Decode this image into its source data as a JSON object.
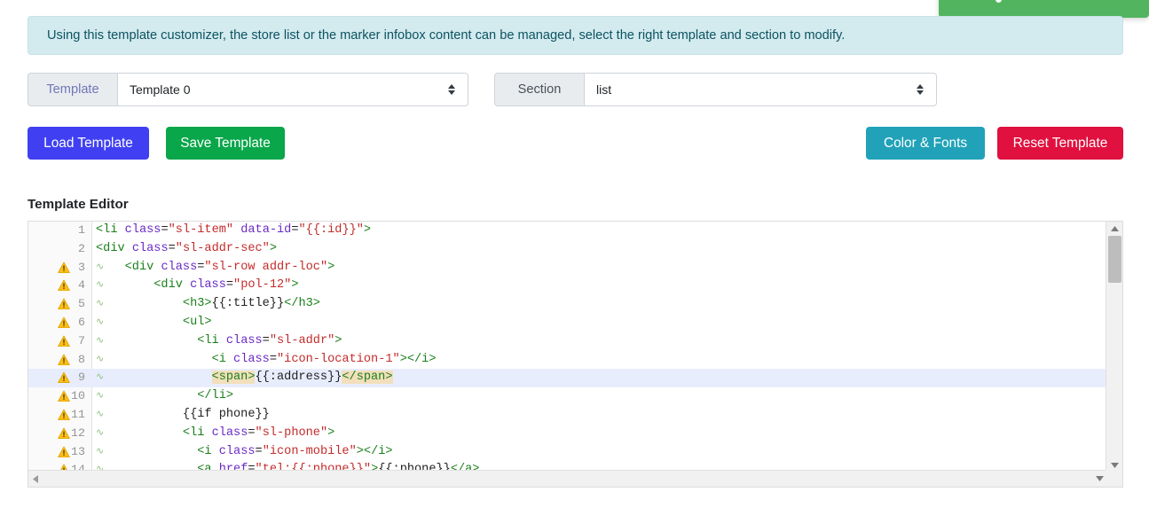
{
  "toast": {
    "name": "success-toast",
    "color": "#52b45f"
  },
  "alert": {
    "text": "Using this template customizer, the store list or the marker infobox content can be managed, select the right template and section to modify.",
    "bg": "#d3eaef",
    "fg": "#0c5460"
  },
  "selectors": {
    "template": {
      "label": "Template",
      "value": "Template 0",
      "options": [
        "Template 0"
      ]
    },
    "section": {
      "label": "Section",
      "value": "list",
      "options": [
        "list"
      ]
    }
  },
  "buttons": {
    "load": {
      "label": "Load Template",
      "color": "#4040f2"
    },
    "save": {
      "label": "Save Template",
      "color": "#09a64a"
    },
    "color_fonts": {
      "label": "Color & Fonts",
      "color": "#21a2b8"
    },
    "reset": {
      "label": "Reset Template",
      "color": "#e0103f"
    }
  },
  "editor": {
    "title": "Template Editor",
    "active_line": 9,
    "lines": [
      {
        "n": "1",
        "warn": false,
        "squiggle": false,
        "tokens": [
          {
            "t": "tag",
            "v": "<li"
          },
          {
            "t": "plain",
            "v": " "
          },
          {
            "t": "attr",
            "v": "class"
          },
          {
            "t": "op",
            "v": "="
          },
          {
            "t": "str",
            "v": "\"sl-item\""
          },
          {
            "t": "plain",
            "v": " "
          },
          {
            "t": "attr",
            "v": "data-id"
          },
          {
            "t": "op",
            "v": "="
          },
          {
            "t": "str",
            "v": "\"{{:id}}\""
          },
          {
            "t": "tag",
            "v": ">"
          }
        ]
      },
      {
        "n": "2",
        "warn": false,
        "squiggle": false,
        "tokens": [
          {
            "t": "tag",
            "v": "<div"
          },
          {
            "t": "plain",
            "v": " "
          },
          {
            "t": "attr",
            "v": "class"
          },
          {
            "t": "op",
            "v": "="
          },
          {
            "t": "str",
            "v": "\"sl-addr-sec\""
          },
          {
            "t": "tag",
            "v": ">"
          }
        ]
      },
      {
        "n": "3",
        "warn": true,
        "squiggle": true,
        "tokens": [
          {
            "t": "plain",
            "v": "    "
          },
          {
            "t": "tag",
            "v": "<div"
          },
          {
            "t": "plain",
            "v": " "
          },
          {
            "t": "attr",
            "v": "class"
          },
          {
            "t": "op",
            "v": "="
          },
          {
            "t": "str",
            "v": "\"sl-row addr-loc\""
          },
          {
            "t": "tag",
            "v": ">"
          }
        ]
      },
      {
        "n": "4",
        "warn": true,
        "squiggle": true,
        "tokens": [
          {
            "t": "plain",
            "v": "        "
          },
          {
            "t": "tag",
            "v": "<div"
          },
          {
            "t": "plain",
            "v": " "
          },
          {
            "t": "attr",
            "v": "class"
          },
          {
            "t": "op",
            "v": "="
          },
          {
            "t": "str",
            "v": "\"pol-12\""
          },
          {
            "t": "tag",
            "v": ">"
          }
        ]
      },
      {
        "n": "5",
        "warn": true,
        "squiggle": true,
        "tokens": [
          {
            "t": "plain",
            "v": "            "
          },
          {
            "t": "tag",
            "v": "<h3>"
          },
          {
            "t": "plain",
            "v": "{{:title}}"
          },
          {
            "t": "tag",
            "v": "</h3>"
          }
        ]
      },
      {
        "n": "6",
        "warn": true,
        "squiggle": true,
        "tokens": [
          {
            "t": "plain",
            "v": "            "
          },
          {
            "t": "tag",
            "v": "<ul>"
          }
        ]
      },
      {
        "n": "7",
        "warn": true,
        "squiggle": true,
        "tokens": [
          {
            "t": "plain",
            "v": "              "
          },
          {
            "t": "tag",
            "v": "<li"
          },
          {
            "t": "plain",
            "v": " "
          },
          {
            "t": "attr",
            "v": "class"
          },
          {
            "t": "op",
            "v": "="
          },
          {
            "t": "str",
            "v": "\"sl-addr\""
          },
          {
            "t": "tag",
            "v": ">"
          }
        ]
      },
      {
        "n": "8",
        "warn": true,
        "squiggle": true,
        "tokens": [
          {
            "t": "plain",
            "v": "                "
          },
          {
            "t": "tag",
            "v": "<i"
          },
          {
            "t": "plain",
            "v": " "
          },
          {
            "t": "attr",
            "v": "class"
          },
          {
            "t": "op",
            "v": "="
          },
          {
            "t": "str",
            "v": "\"icon-location-1\""
          },
          {
            "t": "tag",
            "v": ">"
          },
          {
            "t": "tag",
            "v": "</i>"
          }
        ]
      },
      {
        "n": "9",
        "warn": true,
        "squiggle": true,
        "active": true,
        "tokens": [
          {
            "t": "plain",
            "v": "                "
          },
          {
            "t": "tag",
            "v": "<span>",
            "hl": true
          },
          {
            "t": "plain",
            "v": "{{:address}}"
          },
          {
            "t": "tag",
            "v": "</span>",
            "hl": true
          }
        ]
      },
      {
        "n": "10",
        "warn": true,
        "squiggle": true,
        "tokens": [
          {
            "t": "plain",
            "v": "              "
          },
          {
            "t": "tag",
            "v": "</li>"
          }
        ]
      },
      {
        "n": "11",
        "warn": true,
        "squiggle": true,
        "tokens": [
          {
            "t": "plain",
            "v": "            "
          },
          {
            "t": "plain",
            "v": "{{if phone}}"
          }
        ]
      },
      {
        "n": "12",
        "warn": true,
        "squiggle": true,
        "tokens": [
          {
            "t": "plain",
            "v": "            "
          },
          {
            "t": "tag",
            "v": "<li"
          },
          {
            "t": "plain",
            "v": " "
          },
          {
            "t": "attr",
            "v": "class"
          },
          {
            "t": "op",
            "v": "="
          },
          {
            "t": "str",
            "v": "\"sl-phone\""
          },
          {
            "t": "tag",
            "v": ">"
          }
        ]
      },
      {
        "n": "13",
        "warn": true,
        "squiggle": true,
        "tokens": [
          {
            "t": "plain",
            "v": "              "
          },
          {
            "t": "tag",
            "v": "<i"
          },
          {
            "t": "plain",
            "v": " "
          },
          {
            "t": "attr",
            "v": "class"
          },
          {
            "t": "op",
            "v": "="
          },
          {
            "t": "str",
            "v": "\"icon-mobile\""
          },
          {
            "t": "tag",
            "v": ">"
          },
          {
            "t": "tag",
            "v": "</i>"
          }
        ]
      },
      {
        "n": "14",
        "warn": true,
        "squiggle": true,
        "tokens": [
          {
            "t": "plain",
            "v": "              "
          },
          {
            "t": "tag",
            "v": "<a"
          },
          {
            "t": "plain",
            "v": " "
          },
          {
            "t": "attr",
            "v": "href"
          },
          {
            "t": "op",
            "v": "="
          },
          {
            "t": "str",
            "v": "\"tel:{{:phone}}\""
          },
          {
            "t": "tag",
            "v": ">"
          },
          {
            "t": "plain",
            "v": "{{:phone}}"
          },
          {
            "t": "tag",
            "v": "</a>"
          }
        ]
      }
    ]
  }
}
